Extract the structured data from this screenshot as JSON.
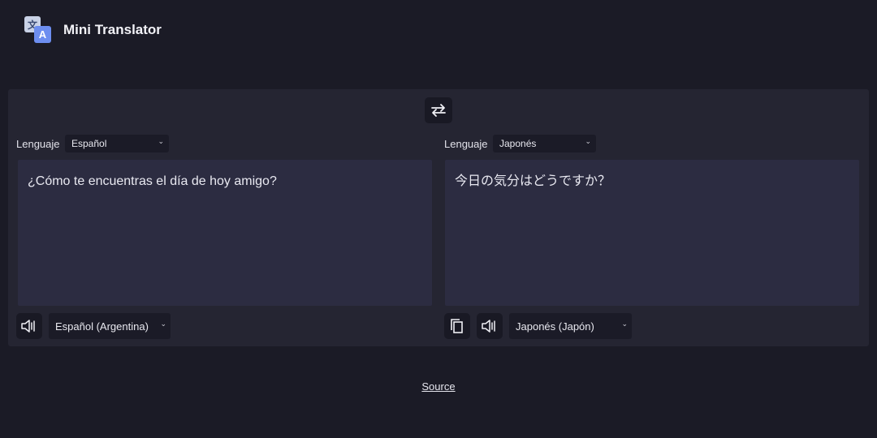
{
  "app": {
    "title": "Mini Translator",
    "logo_left": "文",
    "logo_right": "A"
  },
  "left": {
    "label": "Lenguaje",
    "language": "Español",
    "text": "¿Cómo te encuentras el día de hoy amigo?",
    "voice": "Español (Argentina)"
  },
  "right": {
    "label": "Lenguaje",
    "language": "Japonés",
    "text": "今日の気分はどうですか？",
    "voice": "Japonés (Japón)"
  },
  "footer": {
    "source_link": "Source"
  },
  "icons": {
    "swap": "swap-arrows-icon",
    "speaker": "speaker-icon",
    "copy": "copy-icon",
    "chevron": "chevron-down-icon"
  },
  "colors": {
    "background": "#1b1b26",
    "panel": "#252532",
    "textarea": "#2c2c41",
    "logo_accent": "#6d8ef0"
  }
}
